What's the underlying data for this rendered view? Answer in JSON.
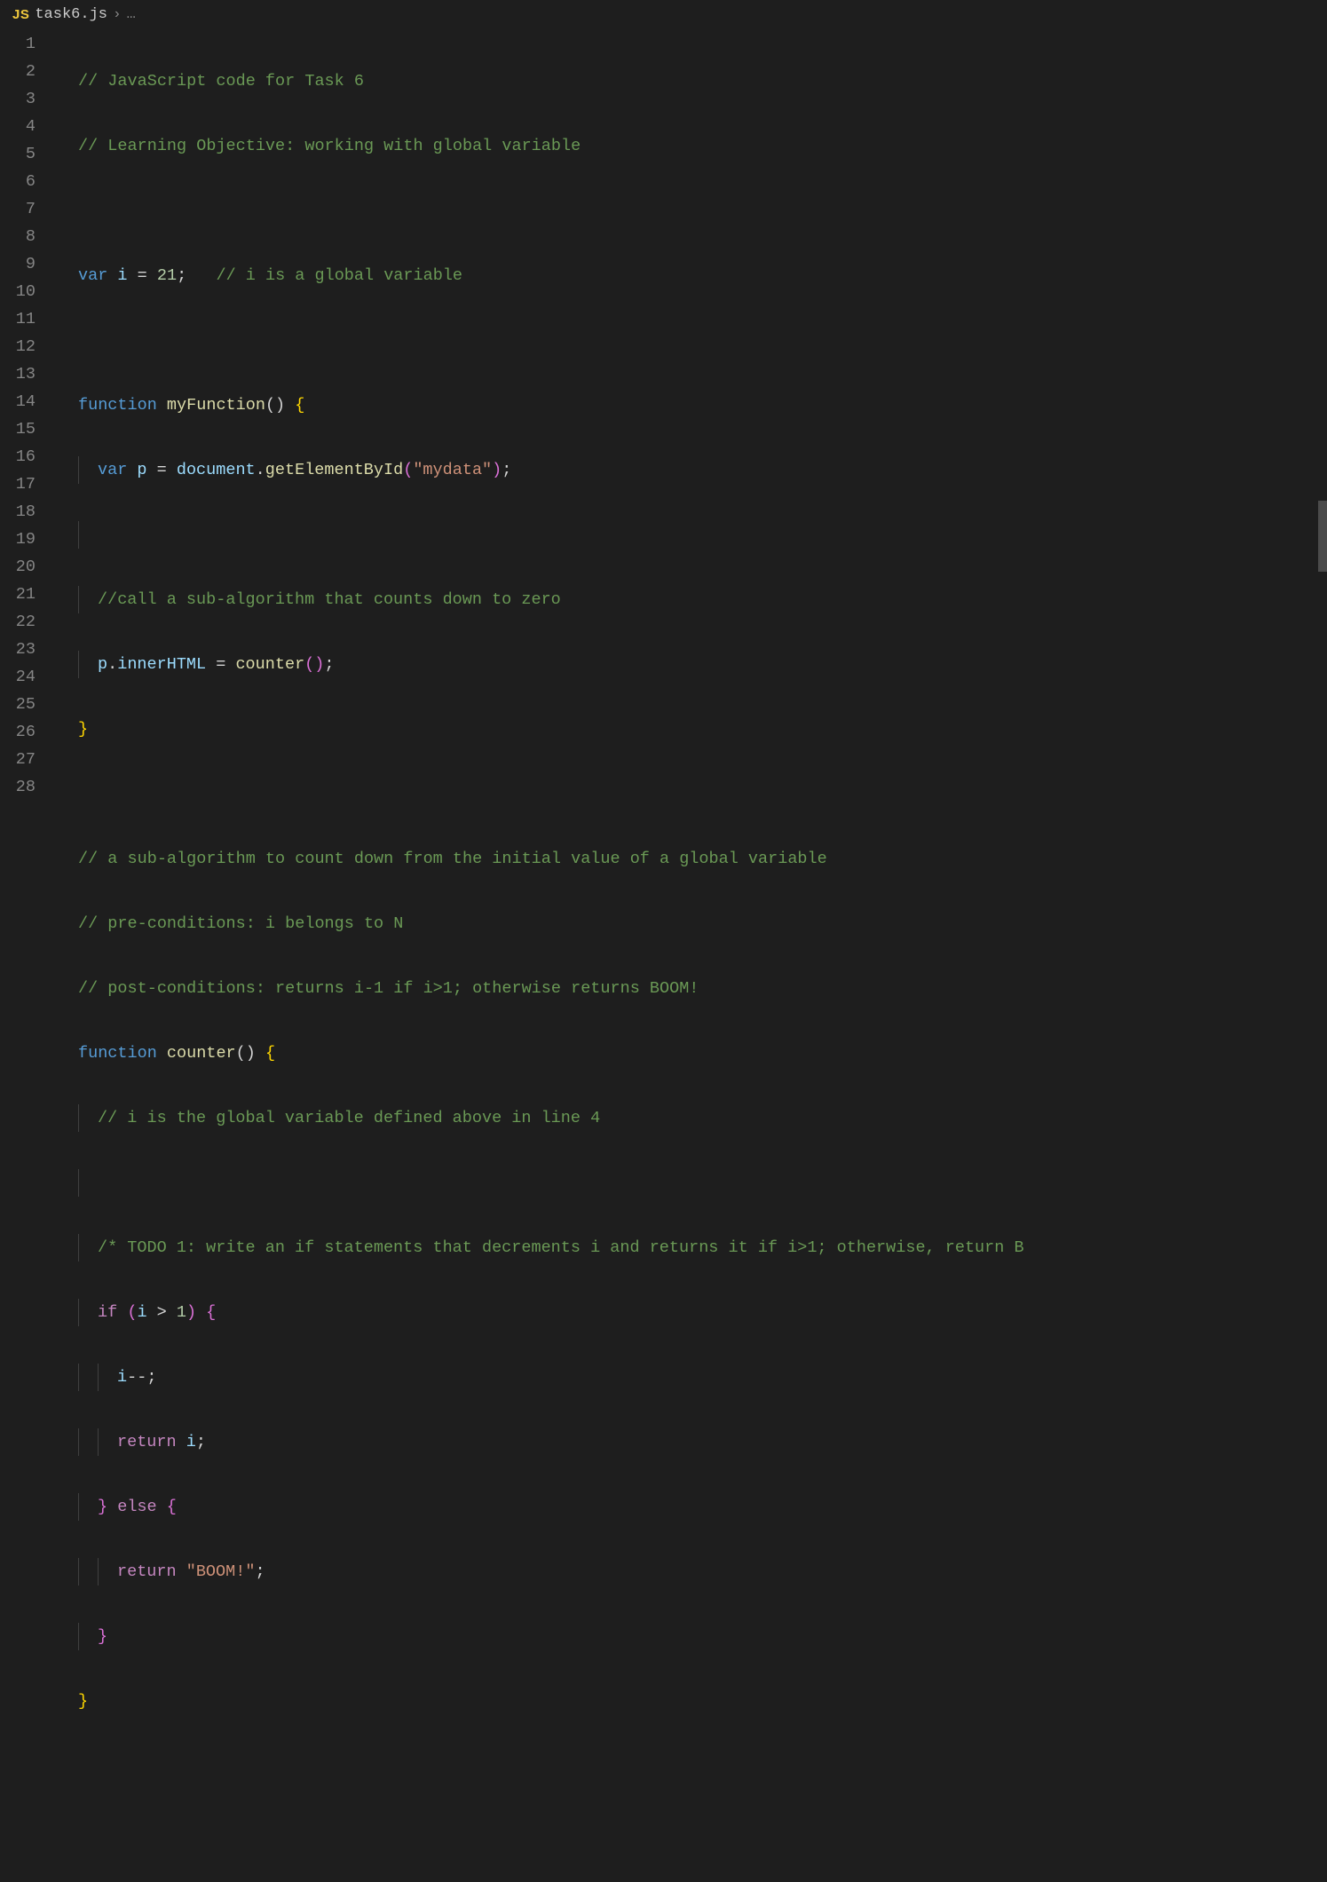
{
  "breadcrumb": {
    "icon_label": "JS",
    "filename": "task6.js",
    "separator": "›",
    "ellipsis": "…"
  },
  "lines": {
    "numbers": [
      "1",
      "2",
      "3",
      "4",
      "5",
      "6",
      "7",
      "8",
      "9",
      "10",
      "11",
      "12",
      "13",
      "14",
      "15",
      "16",
      "17",
      "18",
      "19",
      "20",
      "21",
      "22",
      "23",
      "24",
      "25",
      "26",
      "27",
      "28"
    ]
  },
  "code": {
    "l1_comment": "// JavaScript code for Task 6",
    "l2_comment": "// Learning Objective: working with global variable",
    "l4_var": "var",
    "l4_i": "i",
    "l4_eq": " = ",
    "l4_num": "21",
    "l4_semi": ";",
    "l4_comment": "   // i is a global variable",
    "l6_func": "function",
    "l6_name": " myFunction",
    "l6_paren": "()",
    "l6_brace": " {",
    "l7_var": "var",
    "l7_p": " p",
    "l7_eq": " = ",
    "l7_doc": "document",
    "l7_dot": ".",
    "l7_method": "getElementById",
    "l7_open": "(",
    "l7_str": "\"mydata\"",
    "l7_close": ")",
    "l7_semi": ";",
    "l9_comment": "//call a sub-algorithm that counts down to zero",
    "l10_p": "p",
    "l10_dot": ".",
    "l10_inner": "innerHTML",
    "l10_eq": " = ",
    "l10_call": "counter",
    "l10_paren": "()",
    "l10_semi": ";",
    "l11_brace": "}",
    "l13_comment": "// a sub-algorithm to count down from the initial value of a global variable",
    "l14_comment": "// pre-conditions: i belongs to N",
    "l15_comment": "// post-conditions: returns i-1 if i>1; otherwise returns BOOM!",
    "l16_func": "function",
    "l16_name": " counter",
    "l16_paren": "()",
    "l16_brace": " {",
    "l17_comment": "// i is the global variable defined above in line 4",
    "l19_comment": "/* TODO 1: write an if statements that decrements i and returns it if i>1; otherwise, return B",
    "l20_if": "if",
    "l20_open": " (",
    "l20_i": "i",
    "l20_op": " > ",
    "l20_num": "1",
    "l20_close": ")",
    "l20_brace": " {",
    "l21_i": "i",
    "l21_dec": "--;",
    "l22_ret": "return",
    "l22_i": " i",
    "l22_semi": ";",
    "l23_brace": "}",
    "l23_else": " else ",
    "l23_brace2": "{",
    "l24_ret": "return",
    "l24_str": " \"BOOM!\"",
    "l24_semi": ";",
    "l25_brace": "}",
    "l26_brace": "}"
  }
}
